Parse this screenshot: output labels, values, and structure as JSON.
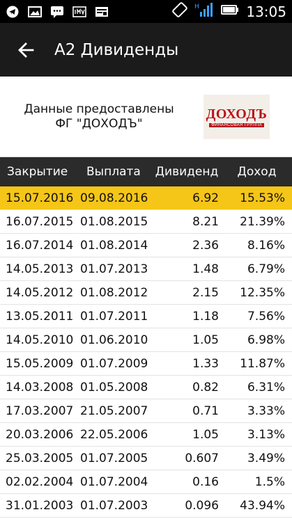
{
  "status_bar": {
    "time": "13:05",
    "left_icons": [
      "telegram-icon",
      "image-icon",
      "chat-icon",
      "app-icon",
      "app-icon"
    ],
    "right_icons": [
      "rotate-icon",
      "signal-icon",
      "battery-icon"
    ]
  },
  "appbar": {
    "title": "A2 Дивиденды",
    "back_icon": "arrow-left-icon"
  },
  "provider": {
    "text_line1": "Данные предоставлены",
    "text_line2": "ФГ \"ДОХОДЪ\"",
    "logo_main": "ДОХОДЪ",
    "logo_sub": "ФИНАНСОВАЯ ГРУППА"
  },
  "table": {
    "headers": [
      "Закрытие",
      "Выплата",
      "Дивиденд",
      "Доход"
    ],
    "highlight_color": "#f5c518",
    "rows": [
      [
        "15.07.2016",
        "09.08.2016",
        "6.92",
        "15.53%"
      ],
      [
        "16.07.2015",
        "01.08.2015",
        "8.21",
        "21.39%"
      ],
      [
        "16.07.2014",
        "01.08.2014",
        "2.36",
        "8.16%"
      ],
      [
        "14.05.2013",
        "01.07.2013",
        "1.48",
        "6.79%"
      ],
      [
        "14.05.2012",
        "01.08.2012",
        "2.15",
        "12.35%"
      ],
      [
        "13.05.2011",
        "01.07.2011",
        "1.18",
        "7.56%"
      ],
      [
        "14.05.2010",
        "01.06.2010",
        "1.05",
        "6.98%"
      ],
      [
        "15.05.2009",
        "01.07.2009",
        "1.33",
        "11.87%"
      ],
      [
        "14.03.2008",
        "01.05.2008",
        "0.82",
        "6.31%"
      ],
      [
        "17.03.2007",
        "21.05.2007",
        "0.71",
        "3.33%"
      ],
      [
        "20.03.2006",
        "22.05.2006",
        "1.05",
        "3.13%"
      ],
      [
        "25.03.2005",
        "01.07.2005",
        "0.607",
        "3.49%"
      ],
      [
        "02.02.2004",
        "01.07.2004",
        "0.16",
        "1.5%"
      ],
      [
        "31.01.2003",
        "01.07.2003",
        "0.096",
        "43.94%"
      ]
    ]
  }
}
